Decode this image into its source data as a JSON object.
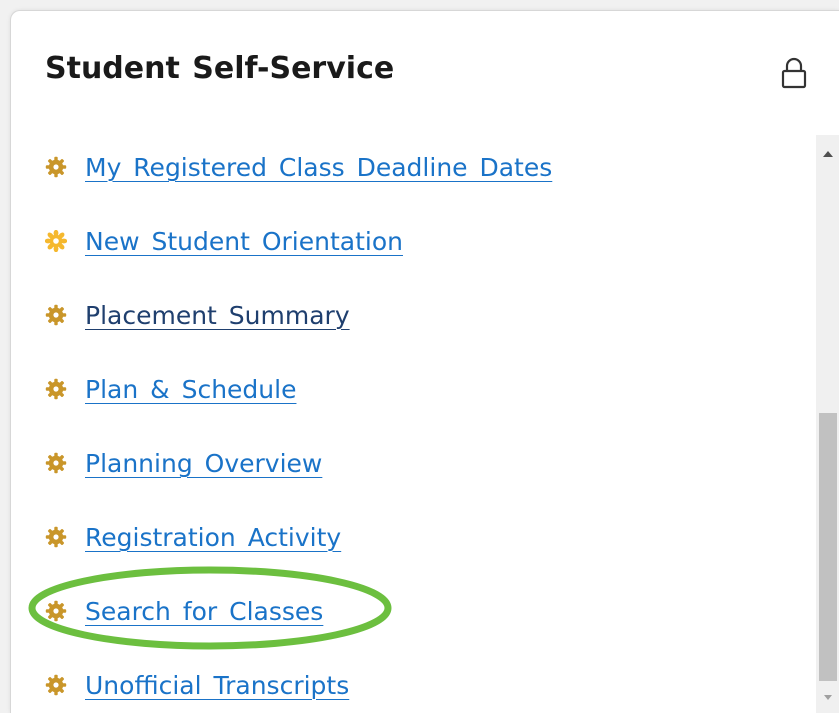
{
  "card": {
    "title": "Student Self-Service",
    "lock_icon": "lock-icon"
  },
  "links": [
    {
      "label": "My Registered Class Deadline Dates",
      "icon": "gear-icon",
      "icon_color": "#c9962a",
      "text_color": "#1a73c8"
    },
    {
      "label": "New Student Orientation",
      "icon": "gear-icon-highlighted",
      "icon_color": "#f5b82e",
      "text_color": "#1a73c8"
    },
    {
      "label": "Placement Summary",
      "icon": "gear-icon",
      "icon_color": "#c9962a",
      "text_color": "#1f3f6e"
    },
    {
      "label": "Plan & Schedule",
      "icon": "gear-icon",
      "icon_color": "#c9962a",
      "text_color": "#1a73c8"
    },
    {
      "label": "Planning Overview",
      "icon": "gear-icon",
      "icon_color": "#c9962a",
      "text_color": "#1a73c8"
    },
    {
      "label": "Registration Activity",
      "icon": "gear-icon",
      "icon_color": "#c9962a",
      "text_color": "#1a73c8"
    },
    {
      "label": "Search for Classes",
      "icon": "gear-icon",
      "icon_color": "#c9962a",
      "text_color": "#1a73c8"
    },
    {
      "label": "Unofficial Transcripts",
      "icon": "gear-icon",
      "icon_color": "#c9962a",
      "text_color": "#1a73c8"
    }
  ],
  "highlight": {
    "target": "Search for Classes",
    "color": "#6cbf3f"
  },
  "scrollbar": {
    "up_icon": "scroll-up-arrow-icon",
    "down_icon": "scroll-down-arrow-icon"
  }
}
